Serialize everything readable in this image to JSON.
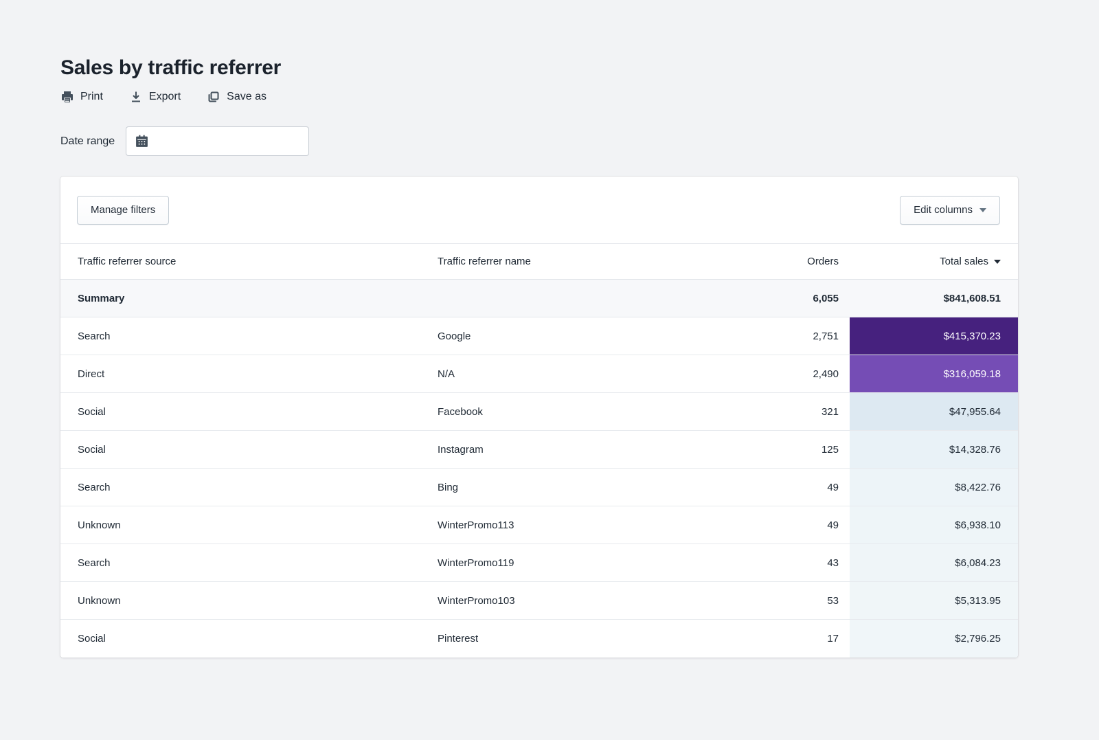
{
  "page": {
    "title": "Sales by traffic referrer",
    "actions": [
      {
        "label": "Print",
        "icon": "printer-icon"
      },
      {
        "label": "Export",
        "icon": "download-icon"
      },
      {
        "label": "Save as",
        "icon": "save-as-icon"
      }
    ],
    "date_range_label": "Date range",
    "date_range_value": "",
    "date_range_icon": "calendar-icon"
  },
  "card": {
    "manage_filters_label": "Manage filters",
    "edit_columns_label": "Edit columns"
  },
  "table": {
    "columns": [
      "Traffic referrer source",
      "Traffic referrer name",
      "Orders",
      "Total sales"
    ],
    "sorted_column": "Total sales",
    "sort_direction": "desc",
    "summary": {
      "label": "Summary",
      "orders": "6,055",
      "total_sales": "$841,608.51"
    },
    "rows": [
      {
        "source": "Search",
        "name": "Google",
        "orders": "2,751",
        "total_sales": "$415,370.23",
        "cell_bg": "#46217e",
        "cell_text": "#ffffff"
      },
      {
        "source": "Direct",
        "name": "N/A",
        "orders": "2,490",
        "total_sales": "$316,059.18",
        "cell_bg": "#754db5",
        "cell_text": "#ffffff"
      },
      {
        "source": "Social",
        "name": "Facebook",
        "orders": "321",
        "total_sales": "$47,955.64",
        "cell_bg": "#dde9f2",
        "cell_text": "#212b36"
      },
      {
        "source": "Social",
        "name": "Instagram",
        "orders": "125",
        "total_sales": "$14,328.76",
        "cell_bg": "#e9f2f7",
        "cell_text": "#212b36"
      },
      {
        "source": "Search",
        "name": "Bing",
        "orders": "49",
        "total_sales": "$8,422.76",
        "cell_bg": "#edf4f8",
        "cell_text": "#212b36"
      },
      {
        "source": "Unknown",
        "name": "WinterPromo113",
        "orders": "49",
        "total_sales": "$6,938.10",
        "cell_bg": "#eef5f8",
        "cell_text": "#212b36"
      },
      {
        "source": "Search",
        "name": "WinterPromo119",
        "orders": "43",
        "total_sales": "$6,084.23",
        "cell_bg": "#eff5f8",
        "cell_text": "#212b36"
      },
      {
        "source": "Unknown",
        "name": "WinterPromo103",
        "orders": "53",
        "total_sales": "$5,313.95",
        "cell_bg": "#f0f6f8",
        "cell_text": "#212b36"
      },
      {
        "source": "Social",
        "name": "Pinterest",
        "orders": "17",
        "total_sales": "$2,796.25",
        "cell_bg": "#f0f6f9",
        "cell_text": "#212b36"
      }
    ]
  },
  "theme": {
    "page_bg": "#f2f3f5",
    "card_bg": "#ffffff",
    "text": "#212b36",
    "icon": "#44505c",
    "heat_max": "#46217e",
    "heat_min": "#f0f6f9"
  }
}
